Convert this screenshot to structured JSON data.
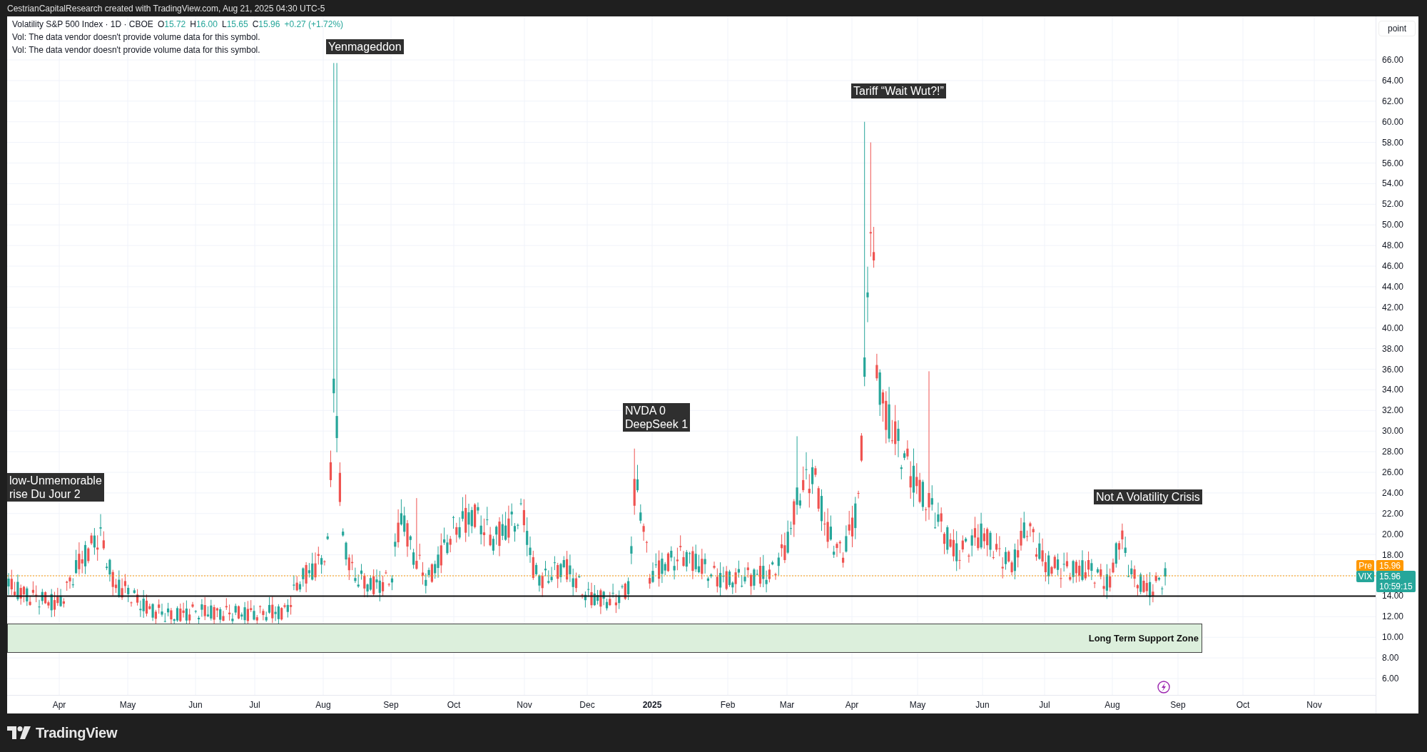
{
  "attribution": "CestrianCapitalResearch created with TradingView.com, Aug 21, 2025 04:30 UTC-5",
  "legend": {
    "symbol": "Volatility S&P 500 Index · 1D · CBOE",
    "ohlc": [
      {
        "label": "O",
        "value": "15.72"
      },
      {
        "label": "H",
        "value": "16.00"
      },
      {
        "label": "L",
        "value": "15.65"
      },
      {
        "label": "C",
        "value": "15.96"
      }
    ],
    "change": "+0.27 (+1.72%)",
    "notes": [
      "Vol: The data vendor doesn't provide volume data for this symbol.",
      "Vol: The data vendor doesn't provide volume data for this symbol."
    ]
  },
  "annotations": [
    {
      "lines": [
        "low-Unmemorable",
        "rise Du Jour 2"
      ]
    },
    {
      "lines": [
        "Yenmageddon"
      ]
    },
    {
      "lines": [
        "NVDA 0",
        "DeepSeek 1"
      ]
    },
    {
      "lines": [
        "Tariff “Wait Wut?!”"
      ]
    },
    {
      "lines": [
        "Not A Volatility Crisis"
      ]
    }
  ],
  "support_zone": {
    "label": "Long Term Support Zone"
  },
  "price_axis": {
    "unit": "point",
    "ticks": [
      "66.00",
      "64.00",
      "62.00",
      "60.00",
      "58.00",
      "56.00",
      "54.00",
      "52.00",
      "50.00",
      "48.00",
      "46.00",
      "44.00",
      "42.00",
      "40.00",
      "38.00",
      "36.00",
      "34.00",
      "32.00",
      "30.00",
      "28.00",
      "26.00",
      "24.00",
      "22.00",
      "20.00",
      "18.00",
      "14.00",
      "12.00",
      "10.00",
      "8.00",
      "6.00"
    ]
  },
  "price_labels": [
    {
      "kind": "pre",
      "tag": "Pre",
      "value": "15.96"
    },
    {
      "kind": "last",
      "tag": "VIX",
      "value": "15.96",
      "countdown": "10:59:15"
    }
  ],
  "time_axis": {
    "labels": [
      {
        "text": "Apr",
        "year": false
      },
      {
        "text": "May",
        "year": false
      },
      {
        "text": "Jun",
        "year": false
      },
      {
        "text": "Jul",
        "year": false
      },
      {
        "text": "Aug",
        "year": false
      },
      {
        "text": "Sep",
        "year": false
      },
      {
        "text": "Oct",
        "year": false
      },
      {
        "text": "Nov",
        "year": false
      },
      {
        "text": "Dec",
        "year": false
      },
      {
        "text": "2025",
        "year": true
      },
      {
        "text": "Feb",
        "year": false
      },
      {
        "text": "Mar",
        "year": false
      },
      {
        "text": "Apr",
        "year": false
      },
      {
        "text": "May",
        "year": false
      },
      {
        "text": "Jun",
        "year": false
      },
      {
        "text": "Jul",
        "year": false
      },
      {
        "text": "Aug",
        "year": false
      },
      {
        "text": "Sep",
        "year": false
      },
      {
        "text": "Oct",
        "year": false
      },
      {
        "text": "Nov",
        "year": false
      }
    ]
  },
  "footer": {
    "brand": "TradingView"
  }
}
